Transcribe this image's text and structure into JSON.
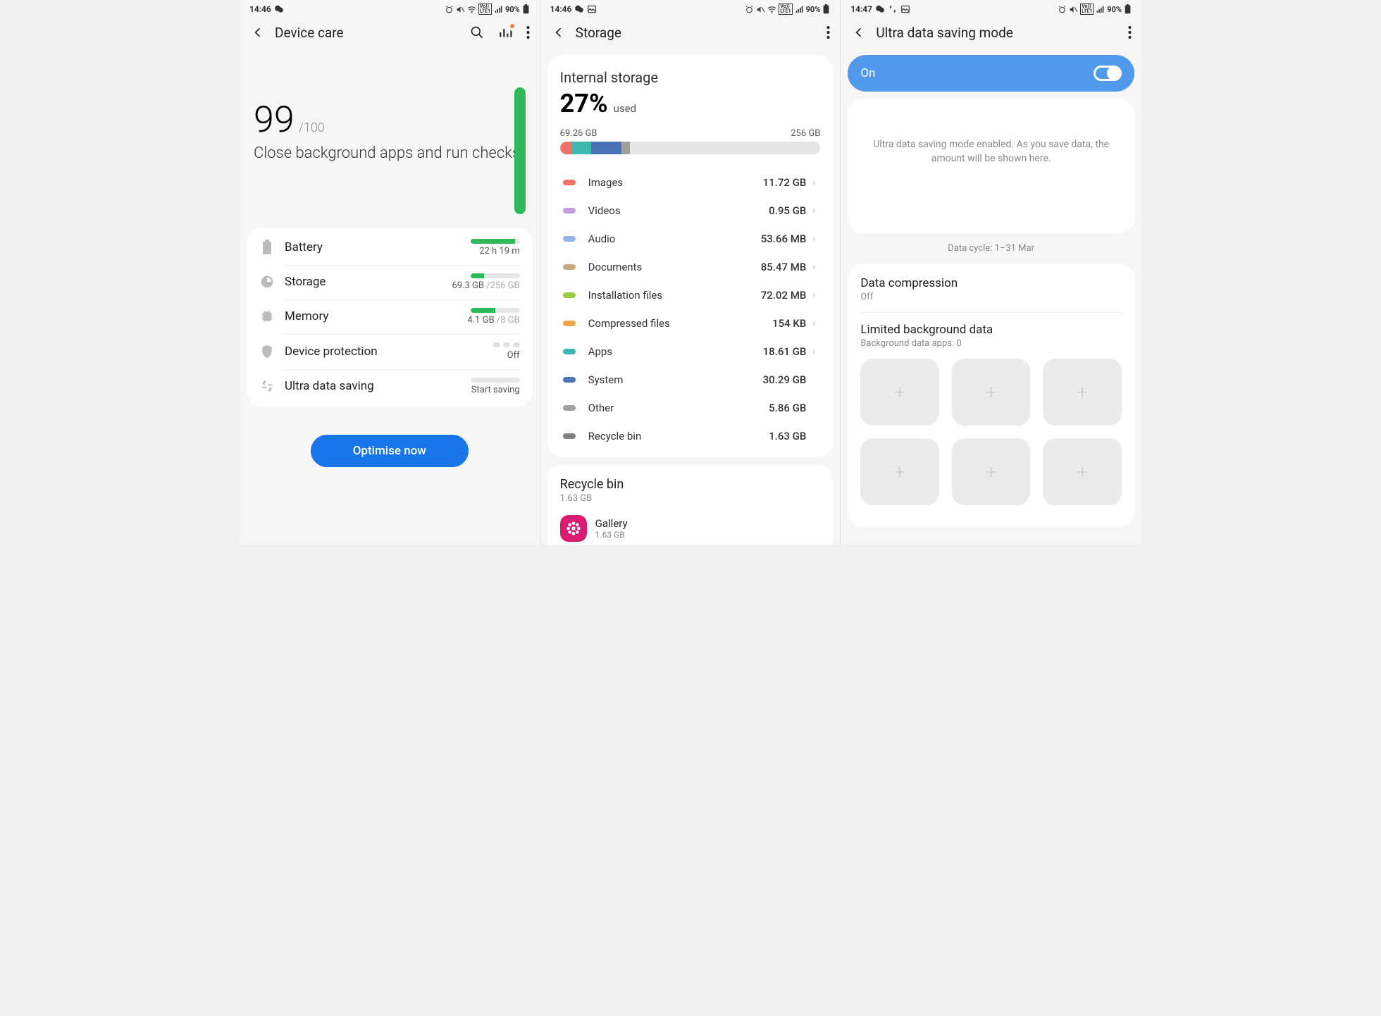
{
  "screens": {
    "care": {
      "status": {
        "time": "14:46",
        "battery": "90%"
      },
      "title": "Device care",
      "score": "99",
      "score_max": "/100",
      "score_sub": "Close background apps and run checks",
      "rows": {
        "battery": {
          "label": "Battery",
          "value": "22 h 19 m"
        },
        "storage": {
          "label": "Storage",
          "used": "69.3 GB",
          "total": " /256 GB"
        },
        "memory": {
          "label": "Memory",
          "used": "4.1 GB",
          "total": " /8 GB"
        },
        "protection": {
          "label": "Device protection",
          "value": "Off"
        },
        "dataSaving": {
          "label": "Ultra data saving",
          "value": "Start saving"
        }
      },
      "button": "Optimise now"
    },
    "storage": {
      "status": {
        "time": "14:46",
        "battery": "90%"
      },
      "title": "Storage",
      "head": {
        "title": "Internal storage",
        "percent": "27%",
        "used_label": "used",
        "used": "69.26 GB",
        "total": "256 GB"
      },
      "categories": [
        {
          "name": "Images",
          "value": "11.72 GB",
          "color": "#ed7367",
          "nav": true
        },
        {
          "name": "Videos",
          "value": "0.95 GB",
          "color": "#c49bdc",
          "nav": true
        },
        {
          "name": "Audio",
          "value": "53.66 MB",
          "color": "#92b5e8",
          "nav": true
        },
        {
          "name": "Documents",
          "value": "85.47 MB",
          "color": "#c8a97a",
          "nav": true
        },
        {
          "name": "Installation files",
          "value": "72.02 MB",
          "color": "#9acc3f",
          "nav": true
        },
        {
          "name": "Compressed files",
          "value": "154 KB",
          "color": "#f0a34a",
          "nav": true
        },
        {
          "name": "Apps",
          "value": "18.61 GB",
          "color": "#3fb8ad",
          "nav": true
        },
        {
          "name": "System",
          "value": "30.29 GB",
          "color": "#4a73b8",
          "nav": false
        },
        {
          "name": "Other",
          "value": "5.86 GB",
          "color": "#a0a0a0",
          "nav": false
        },
        {
          "name": "Recycle bin",
          "value": "1.63 GB",
          "color": "#808080",
          "nav": false
        }
      ],
      "recycle": {
        "title": "Recycle bin",
        "size": "1.63 GB",
        "app": {
          "name": "Gallery",
          "size": "1.63 GB"
        }
      }
    },
    "uds": {
      "status": {
        "time": "14:47",
        "battery": "90%"
      },
      "title": "Ultra data saving mode",
      "toggle_label": "On",
      "info": "Ultra data saving mode enabled. As you save data, the amount will be shown here.",
      "cycle": "Data cycle: 1–31 Mar",
      "compression": {
        "title": "Data compression",
        "value": "Off"
      },
      "limited": {
        "title": "Limited background data",
        "value": "Background data apps: 0"
      }
    }
  }
}
